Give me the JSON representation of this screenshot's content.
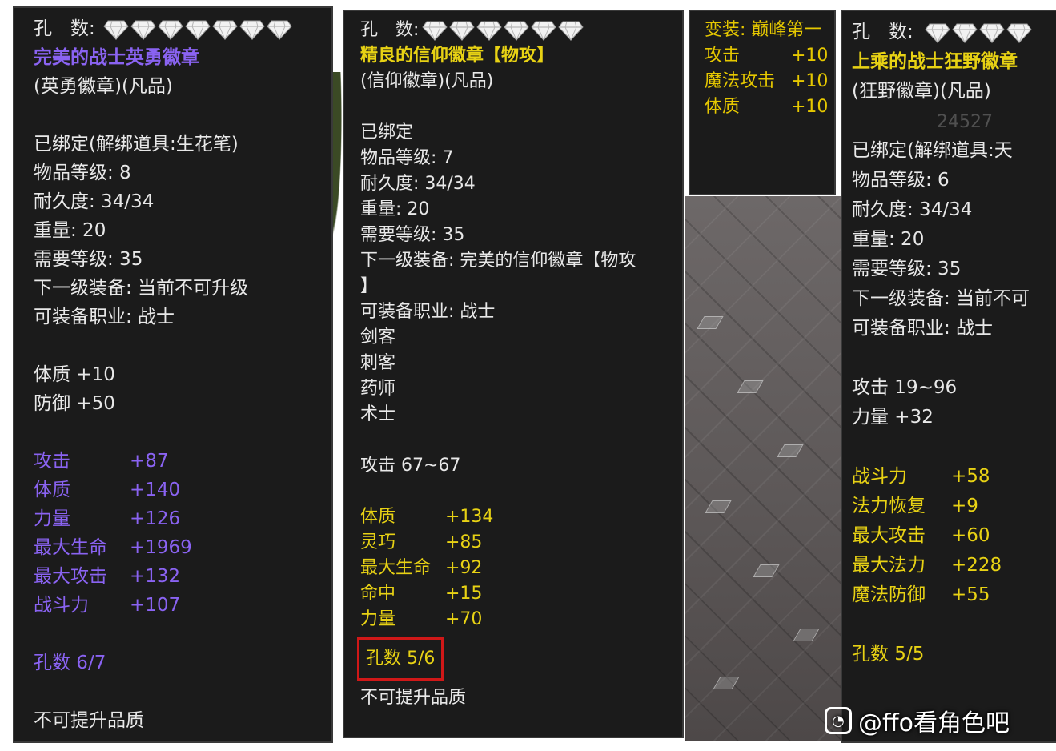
{
  "colors": {
    "panel_bg": "#1b1b1b",
    "white_text": "#e8e8e8",
    "purple_text": "#8a63f2",
    "yellow_text": "#e8d214",
    "highlight_box": "#d01818"
  },
  "panel1": {
    "hole_label": "孔　数:",
    "gems_count": 7,
    "name": "完美的战士英勇徽章",
    "type": "(英勇徽章)(凡品)",
    "bound": "已绑定(解绑道具:生花笔)",
    "item_level": "物品等级: 8",
    "durability": "耐久度: 34/34",
    "weight": "重量: 20",
    "req_level": "需要等级: 35",
    "next_equip": "下一级装备: 当前不可升级",
    "class": "可装备职业: 战士",
    "base_stats": [
      "体质 +10",
      "防御 +50"
    ],
    "extra_stats": [
      {
        "k": "攻击",
        "v": "+87"
      },
      {
        "k": "体质",
        "v": "+140"
      },
      {
        "k": "力量",
        "v": "+126"
      },
      {
        "k": "最大生命",
        "v": "+1969"
      },
      {
        "k": "最大攻击",
        "v": "+132"
      },
      {
        "k": "战斗力",
        "v": "+107"
      }
    ],
    "holes": "孔数 6/7",
    "footer": "不可提升品质"
  },
  "panel2": {
    "hole_label": "孔　数:",
    "gems_count": 6,
    "name": "精良的信仰徽章【物攻】",
    "type": "(信仰徽章)(凡品)",
    "bound": "已绑定",
    "item_level": "物品等级: 7",
    "durability": "耐久度: 34/34",
    "weight": "重量: 20",
    "req_level": "需要等级: 35",
    "next_equip_1": "下一级装备: 完美的信仰徽章【物攻",
    "next_equip_2": "】",
    "class": "可装备职业: 战士",
    "classes_more": [
      "剑客",
      "刺客",
      "药师",
      "术士"
    ],
    "attack": "攻击 67~67",
    "extra_stats": [
      {
        "k": "体质",
        "v": "+134"
      },
      {
        "k": "灵巧",
        "v": "+85"
      },
      {
        "k": "最大生命",
        "v": "+92"
      },
      {
        "k": "命中",
        "v": "+15"
      },
      {
        "k": "力量",
        "v": "+70"
      }
    ],
    "holes": "孔数 5/6",
    "footer": "不可提升品质"
  },
  "panel3": {
    "title": "变装: 巅峰第一",
    "stats": [
      {
        "k": "攻击",
        "v": "+10"
      },
      {
        "k": "魔法攻击",
        "v": "+10"
      },
      {
        "k": "体质",
        "v": "+10"
      }
    ]
  },
  "panel4": {
    "hole_label": "孔　数:",
    "gems_count": 4,
    "name": "上乘的战士狂野徽章",
    "type": "(狂野徽章)(凡品)",
    "bound": "已绑定(解绑道具:天",
    "item_level": "物品等级: 6",
    "durability": "耐久度: 34/34",
    "weight": "重量: 20",
    "req_level": "需要等级: 35",
    "next_equip": "下一级装备: 当前不可",
    "class": "可装备职业: 战士",
    "attack": "攻击 19~96",
    "strength": "力量 +32",
    "extra_stats": [
      {
        "k": "战斗力",
        "v": "+58"
      },
      {
        "k": "法力恢复",
        "v": "+9"
      },
      {
        "k": "最大攻击",
        "v": "+60"
      },
      {
        "k": "最大法力",
        "v": "+228"
      },
      {
        "k": "魔法防御",
        "v": "+55"
      }
    ],
    "holes": "孔数 5/5",
    "overlay": [
      "24527"
    ]
  },
  "watermark": {
    "text": "@ffo看角色吧",
    "icon": "tieba-icon"
  }
}
